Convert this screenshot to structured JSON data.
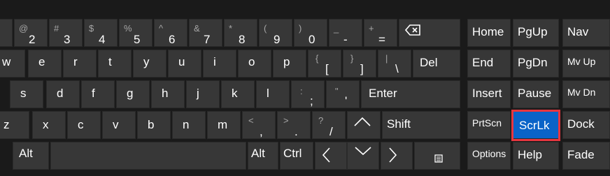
{
  "keyboard": {
    "row1": [
      {
        "main": "",
        "shift": ""
      },
      {
        "main": "2",
        "shift": "@"
      },
      {
        "main": "3",
        "shift": "#"
      },
      {
        "main": "4",
        "shift": "$"
      },
      {
        "main": "5",
        "shift": "%"
      },
      {
        "main": "6",
        "shift": "^"
      },
      {
        "main": "7",
        "shift": "&"
      },
      {
        "main": "8",
        "shift": "*"
      },
      {
        "main": "9",
        "shift": "("
      },
      {
        "main": "0",
        "shift": ")"
      },
      {
        "main": "-",
        "shift": "_"
      },
      {
        "main": "=",
        "shift": "+"
      }
    ],
    "backspace_icon": "backspace-icon",
    "row2_letters": [
      "w",
      "e",
      "r",
      "t",
      "y",
      "u",
      "i",
      "o",
      "p"
    ],
    "row2_brackets": [
      {
        "main": "[",
        "shift": "{"
      },
      {
        "main": "]",
        "shift": "}"
      },
      {
        "main": "\\",
        "shift": "|"
      }
    ],
    "del": "Del",
    "row3_letters": [
      "s",
      "d",
      "f",
      "g",
      "h",
      "j",
      "k",
      "l"
    ],
    "row3_punct": [
      {
        "main": ";",
        "shift": ":"
      },
      {
        "main": "'",
        "shift": "\""
      }
    ],
    "enter": "Enter",
    "row4_letters": [
      "z",
      "x",
      "c",
      "v",
      "b",
      "n",
      "m"
    ],
    "row4_punct": [
      {
        "main": ",",
        "shift": "<"
      },
      {
        "main": ".",
        "shift": ">"
      },
      {
        "main": "/",
        "shift": "?"
      }
    ],
    "up_arrow": "^",
    "shift": "Shift",
    "alt_left": "Alt",
    "alt_right": "Alt",
    "ctrl": "Ctrl",
    "left_arrow": "<",
    "down_arrow": "v",
    "right_arrow": ">",
    "menu_icon": "menu-icon"
  },
  "nav_keys": [
    [
      "Home",
      "PgUp",
      "Nav"
    ],
    [
      "End",
      "PgDn",
      "Mv Up"
    ],
    [
      "Insert",
      "Pause",
      "Mv Dn"
    ],
    [
      "PrtScn",
      "ScrLk",
      "Dock"
    ],
    [
      "Options",
      "Help",
      "Fade"
    ]
  ],
  "selected_key": "ScrLk",
  "colors": {
    "background": "#1a1a1a",
    "key": "#373737",
    "key_text": "#ffffff",
    "secondary_text": "#a6a6a6",
    "selected_key": "#0a63c8",
    "selection_outline": "#e8363f"
  }
}
